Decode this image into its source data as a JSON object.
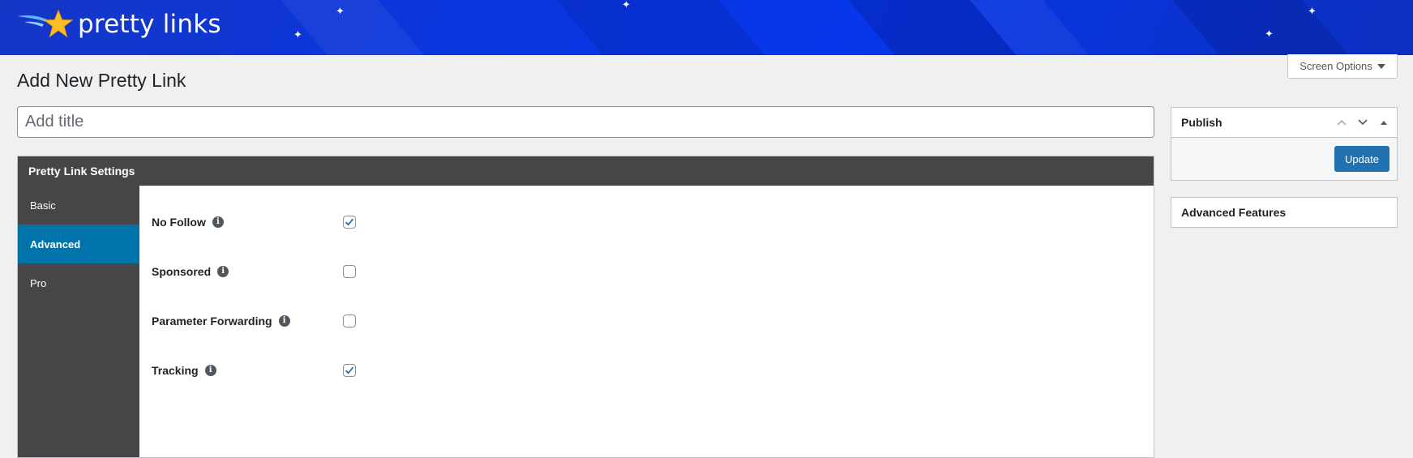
{
  "brand": {
    "logo_text": "pretty links",
    "colors": {
      "banner": "#0a36e0",
      "star": "#fbbf24",
      "accent": "#2271b1",
      "tab_active": "#0073aa",
      "dark_panel": "#464646"
    }
  },
  "screen_options": {
    "label": "Screen Options",
    "icon": "caret-down-icon"
  },
  "page": {
    "title": "Add New Pretty Link"
  },
  "title_field": {
    "placeholder": "Add title",
    "value": ""
  },
  "settings": {
    "header": "Pretty Link Settings",
    "tabs": [
      {
        "label": "Basic",
        "active": false
      },
      {
        "label": "Advanced",
        "active": true
      },
      {
        "label": "Pro",
        "active": false
      }
    ],
    "options": [
      {
        "label": "No Follow",
        "checked": true,
        "icon": "info-icon"
      },
      {
        "label": "Sponsored",
        "checked": false,
        "icon": "info-icon"
      },
      {
        "label": "Parameter Forwarding",
        "checked": false,
        "icon": "info-icon"
      },
      {
        "label": "Tracking",
        "checked": true,
        "icon": "info-icon"
      }
    ]
  },
  "publish": {
    "title": "Publish",
    "controls": [
      "chevron-up-icon",
      "chevron-down-icon",
      "collapse-triangle-icon"
    ],
    "update_label": "Update"
  },
  "advanced_features": {
    "title": "Advanced Features"
  }
}
